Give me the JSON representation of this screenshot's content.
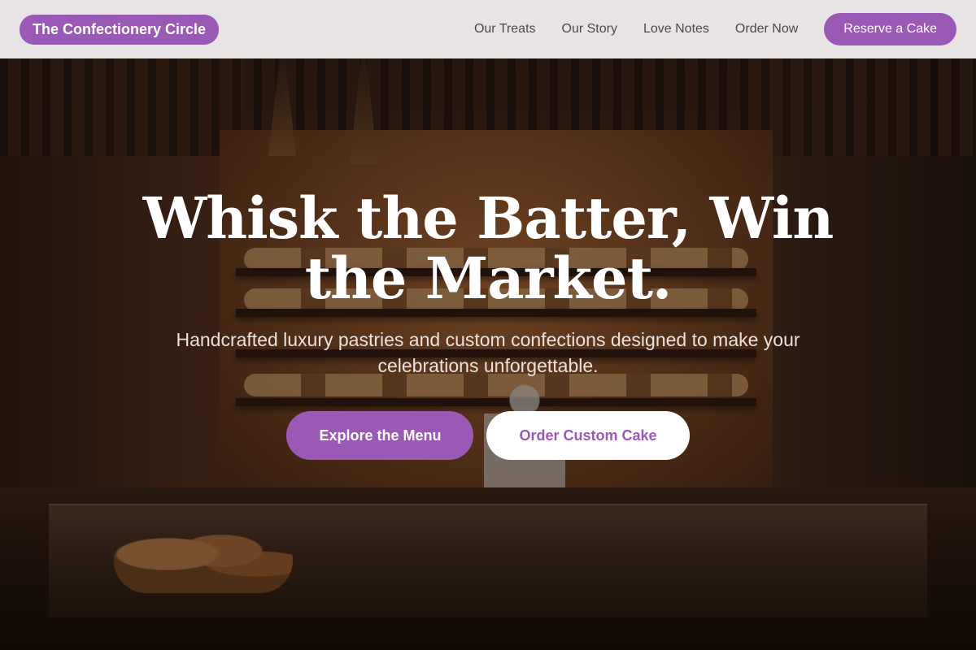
{
  "header": {
    "brand": "The Confectionery Circle",
    "nav": [
      {
        "label": "Our Treats"
      },
      {
        "label": "Our Story"
      },
      {
        "label": "Love Notes"
      },
      {
        "label": "Order Now"
      }
    ],
    "cta_label": "Reserve a Cake"
  },
  "hero": {
    "title": "Whisk the Batter, Win the Market.",
    "subtitle": "Handcrafted luxury pastries and custom confections designed to make your celebrations unforgettable.",
    "primary_button": "Explore the Menu",
    "secondary_button": "Order Custom Cake",
    "background_image": "bakery-interior-photo"
  },
  "colors": {
    "accent": "#9b59b6",
    "header_bg": "#eeebec",
    "title_text": "#ffffff"
  }
}
